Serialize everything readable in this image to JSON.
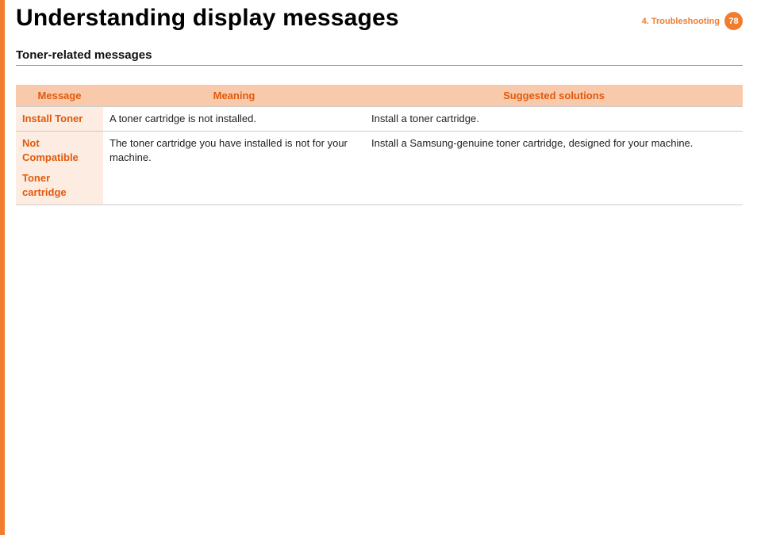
{
  "header": {
    "title": "Understanding display messages",
    "chapter_label": "4.  Troubleshooting",
    "page_number": "78"
  },
  "section": {
    "title": "Toner-related messages",
    "columns": {
      "message": "Message",
      "meaning": "Meaning",
      "solutions": "Suggested solutions"
    },
    "rows": [
      {
        "message_main": "Install Toner",
        "message_sub": "",
        "meaning": "A toner cartridge is not installed.",
        "solutions": "Install a toner cartridge."
      },
      {
        "message_main": "Not Compatible",
        "message_sub": "Toner cartridge",
        "meaning": "The toner cartridge you have installed is not for your machine.",
        "solutions": "Install a Samsung-genuine toner cartridge, designed for your machine."
      }
    ]
  }
}
